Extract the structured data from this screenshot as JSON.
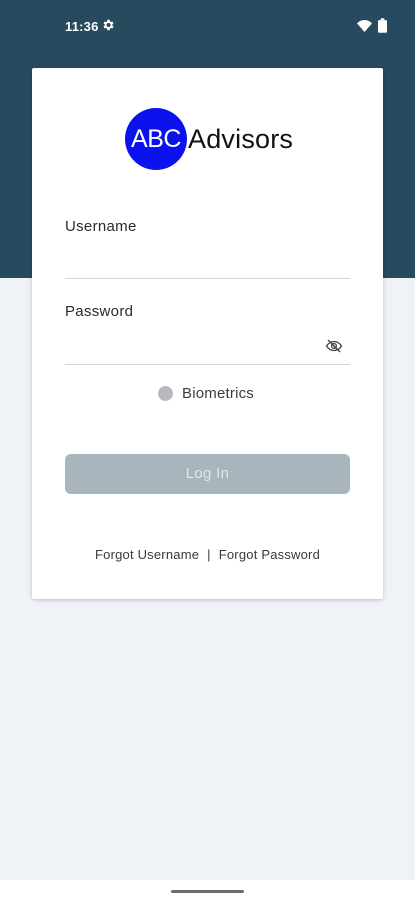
{
  "status_bar": {
    "time": "11:36",
    "icons": [
      "gear-icon",
      "wifi-icon",
      "battery-icon"
    ]
  },
  "brand": {
    "logo_initials": "ABC",
    "logo_word": "Advisors",
    "logo_color": "#0b12ee",
    "header_color": "#284a5e"
  },
  "form": {
    "username_label": "Username",
    "username_value": "",
    "password_label": "Password",
    "password_value": "",
    "password_toggle_icon": "eye-off-icon",
    "biometrics_label": "Biometrics",
    "login_label": "Log In"
  },
  "links": {
    "forgot_username": "Forgot Username",
    "separator": "|",
    "forgot_password": "Forgot Password"
  }
}
